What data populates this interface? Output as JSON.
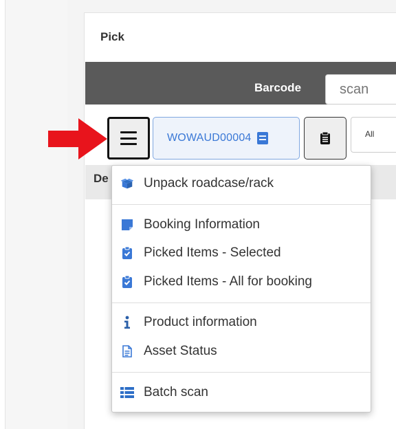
{
  "panel": {
    "title": "Pick"
  },
  "barcode": {
    "label": "Barcode",
    "placeholder": "scan"
  },
  "toolbar": {
    "menu_icon": "hamburger-icon",
    "booking_code": "WOWAUD00004",
    "booking_icon": "document-icon",
    "clipboard_icon": "clipboard-icon",
    "filter_value": "All"
  },
  "table": {
    "header_text": "De"
  },
  "annotation": {
    "arrow_color": "#e8141c"
  },
  "dropdown": {
    "groups": [
      [
        {
          "label": "Unpack roadcase/rack",
          "icon": "open-box-icon"
        }
      ],
      [
        {
          "label": "Booking Information",
          "icon": "sticky-note-icon"
        },
        {
          "label": "Picked Items - Selected",
          "icon": "clipboard-check-icon"
        },
        {
          "label": "Picked Items - All for booking",
          "icon": "clipboard-check-icon"
        }
      ],
      [
        {
          "label": "Product information",
          "icon": "info-icon"
        },
        {
          "label": "Asset Status",
          "icon": "file-text-icon"
        }
      ],
      [
        {
          "label": "Batch scan",
          "icon": "list-icon"
        }
      ]
    ]
  },
  "colors": {
    "accent_blue": "#3a78d6",
    "dark_bar": "#5a5a5a"
  }
}
